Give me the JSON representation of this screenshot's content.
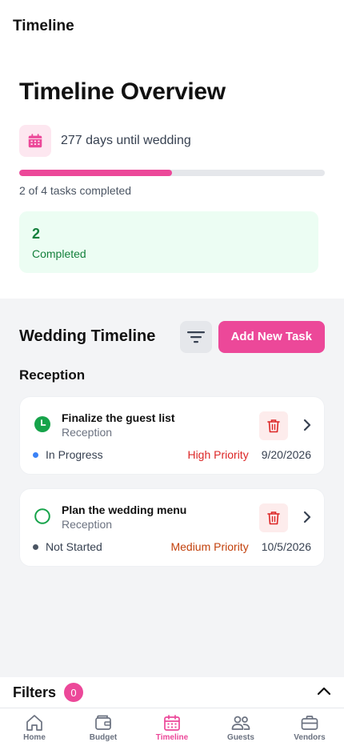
{
  "header": {
    "title": "Timeline"
  },
  "overview": {
    "title": "Timeline Overview",
    "days_text": "277 days until wedding",
    "progress_fraction": 0.5,
    "tasks_text": "2 of 4 tasks completed",
    "completed_count": "2",
    "completed_label": "Completed"
  },
  "timeline": {
    "title": "Wedding Timeline",
    "add_button": "Add New Task",
    "section": "Reception",
    "tasks": [
      {
        "name": "Finalize the guest list",
        "category": "Reception",
        "status": "In Progress",
        "priority": "High Priority",
        "date": "9/20/2026"
      },
      {
        "name": "Plan the wedding menu",
        "category": "Reception",
        "status": "Not Started",
        "priority": "Medium Priority",
        "date": "10/5/2026"
      }
    ]
  },
  "filters": {
    "title": "Filters",
    "count": "0"
  },
  "nav": {
    "items": [
      {
        "label": "Home",
        "icon": "home-icon"
      },
      {
        "label": "Budget",
        "icon": "wallet-icon"
      },
      {
        "label": "Timeline",
        "icon": "calendar-icon"
      },
      {
        "label": "Guests",
        "icon": "users-icon"
      },
      {
        "label": "Vendors",
        "icon": "briefcase-icon"
      }
    ],
    "active": "Timeline"
  },
  "colors": {
    "accent": "#ec4899",
    "completed_bg": "#ecfdf3",
    "completed_text": "#15803d",
    "in_progress_dot": "#3b82f6",
    "not_started_dot": "#4b5563",
    "high_priority": "#dc2626",
    "medium_priority": "#c2410c"
  }
}
